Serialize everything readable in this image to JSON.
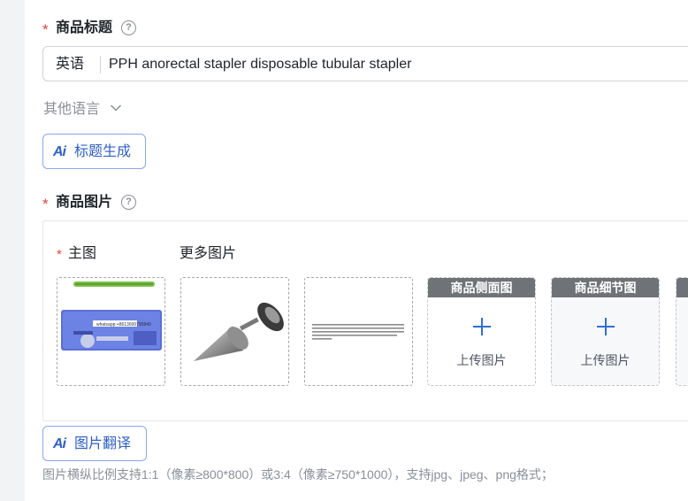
{
  "title_section": {
    "required_mark": "*",
    "label": "商品标题",
    "help_icon": "question-circle-icon",
    "language": "英语",
    "value": "PPH anorectal stapler disposable tubular stapler",
    "other_languages": "其他语言",
    "ai_button": {
      "icon_text": "Ai",
      "label": "标题生成"
    }
  },
  "image_section": {
    "required_mark": "*",
    "label": "商品图片",
    "help_icon": "question-circle-icon",
    "main_label": "主图",
    "more_label": "更多图片",
    "main_image_caption": "whatsapp:+8613600795840",
    "upload_slots": [
      {
        "header": "商品侧面图",
        "text": "上传图片"
      },
      {
        "header": "商品细节图",
        "text": "上传图片"
      }
    ],
    "ai_button": {
      "icon_text": "Ai",
      "label": "图片翻译"
    },
    "hint": "图片横纵比例支持1:1（像素≥800*800）或3:4（像素≥750*1000），支持jpg、jpeg、png格式；"
  },
  "colors": {
    "required": "#e0443a",
    "ai_accent": "#2f5fc7",
    "upload_plus": "#2f6fd6",
    "slot_header": "#6f7378"
  }
}
